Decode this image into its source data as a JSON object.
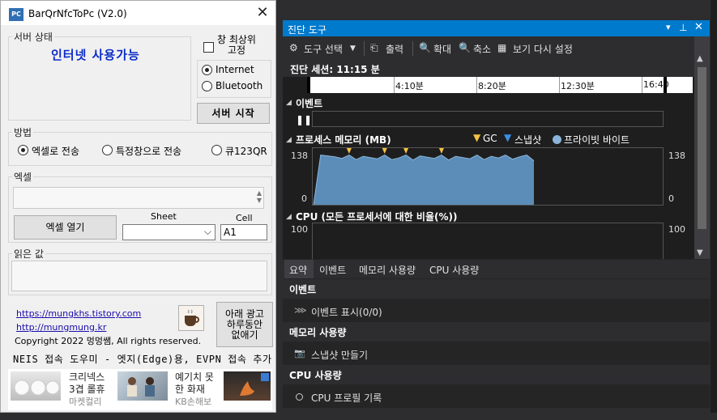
{
  "window": {
    "title": "BarQrNfcToPc (V2.0)",
    "icon_text": "PC",
    "close_symbol": "✕"
  },
  "server": {
    "group_label": "서버 상태",
    "status_text": "인터넷 사용가능",
    "always_on_top_label_line1": "창 최상위",
    "always_on_top_label_line2": "고정",
    "internet_label": "Internet",
    "bluetooth_label": "Bluetooth",
    "start_button": "서버 시작"
  },
  "method": {
    "group_label": "방법",
    "options": [
      "엑셀로 전송",
      "특정창으로 전송",
      "큐123QR"
    ],
    "selected": "엑셀로 전송"
  },
  "excel": {
    "group_label": "엑셀",
    "open_button": "엑셀 열기",
    "sheet_label": "Sheet",
    "cell_label": "Cell",
    "cell_value": "A1"
  },
  "read_value": {
    "group_label": "읽은 값"
  },
  "footer": {
    "link1": "https://mungkhs.tistory.com",
    "link2": "http://mungmung.kr",
    "copyright": "Copyright 2022 멍멍쌤, All rights reserved.",
    "hide_ad_button_line1": "아래 광고",
    "hide_ad_button_line2": "하루동안",
    "hide_ad_button_line3": "없애기",
    "neis_text": "NEIS 접속 도우미 - 엣지(Edge)용, EVPN 접속 추가"
  },
  "ads": [
    {
      "title_line1": "크리넥스",
      "title_line2": "3겹 롤휴",
      "brand": "마켓컬리"
    },
    {
      "title_line1": "예기치 못",
      "title_line2": "한 화재",
      "brand": "KB손해보"
    }
  ],
  "diag": {
    "title": "진단 도구",
    "toolbar": {
      "select_tools": "도구 선택",
      "output": "출력",
      "zoom_in": "확대",
      "zoom_out": "축소",
      "reset_view": "보기 다시 설정"
    },
    "session_label": "진단 세션: 11:15 분",
    "timeline_ticks": [
      "4:10분",
      "8:20분",
      "12:30분",
      "16:40"
    ],
    "events_label": "이벤트",
    "memory_label": "프로세스 메모리 (MB)",
    "legend": {
      "gc": "GC",
      "snapshot": "스냅샷",
      "private_bytes": "프라이빗 바이트"
    },
    "memory_max": "138",
    "memory_min": "0",
    "cpu_label": "CPU (모든 프로세서에 대한 비율(%))",
    "cpu_max": "100",
    "tabs": [
      "요약",
      "이벤트",
      "메모리 사용량",
      "CPU 사용량"
    ],
    "sections": [
      {
        "header": "이벤트",
        "row": "이벤트 표시(0/0)",
        "icon": "events-icon"
      },
      {
        "header": "메모리 사용량",
        "row": "스냅샷 만들기",
        "icon": "camera-icon"
      },
      {
        "header": "CPU 사용량",
        "row": "CPU 프로필 기록",
        "icon": "record-icon"
      }
    ],
    "colors": {
      "accent": "#007acc",
      "memory_fill": "#5b8db8",
      "gc_marker": "#f5c242",
      "snapshot_marker": "#3a8ee6",
      "private_bytes": "#8ab4d9"
    }
  },
  "chart_data": {
    "type": "area",
    "title": "프로세스 메모리 (MB)",
    "xlabel": "",
    "ylabel": "",
    "ylim": [
      0,
      138
    ],
    "series": [
      {
        "name": "프라이빗 바이트",
        "values": [
          0,
          121,
          119,
          117,
          113,
          121,
          110,
          118,
          115,
          112,
          121,
          110,
          114,
          121,
          109,
          119,
          116,
          113,
          121,
          109,
          118,
          115,
          112,
          121,
          110,
          118,
          114,
          121,
          111,
          117,
          121,
          107
        ]
      }
    ]
  }
}
